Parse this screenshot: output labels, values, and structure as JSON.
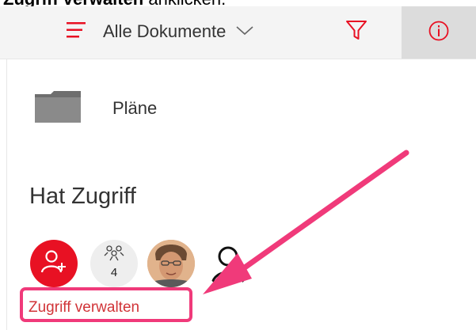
{
  "caption": {
    "bold_text": "Zugriff verwalten",
    "rest_text": " anklicken."
  },
  "toolbar": {
    "view_label": "Alle Dokumente",
    "view_icon": "list-lines-icon",
    "dropdown_icon": "chevron-down-icon",
    "filter_icon": "filter-icon",
    "info_icon": "info-icon"
  },
  "file": {
    "name": "Pläne",
    "icon": "folder-icon"
  },
  "access": {
    "title": "Hat Zugriff",
    "group_count": "4",
    "manage_link": "Zugriff verwalten"
  },
  "colors": {
    "accent": "#e81123",
    "link": "#d13438",
    "highlight": "#f03a7a",
    "toolbar_bg": "#f4f4f4",
    "active_btn_bg": "#dcdcdc"
  }
}
